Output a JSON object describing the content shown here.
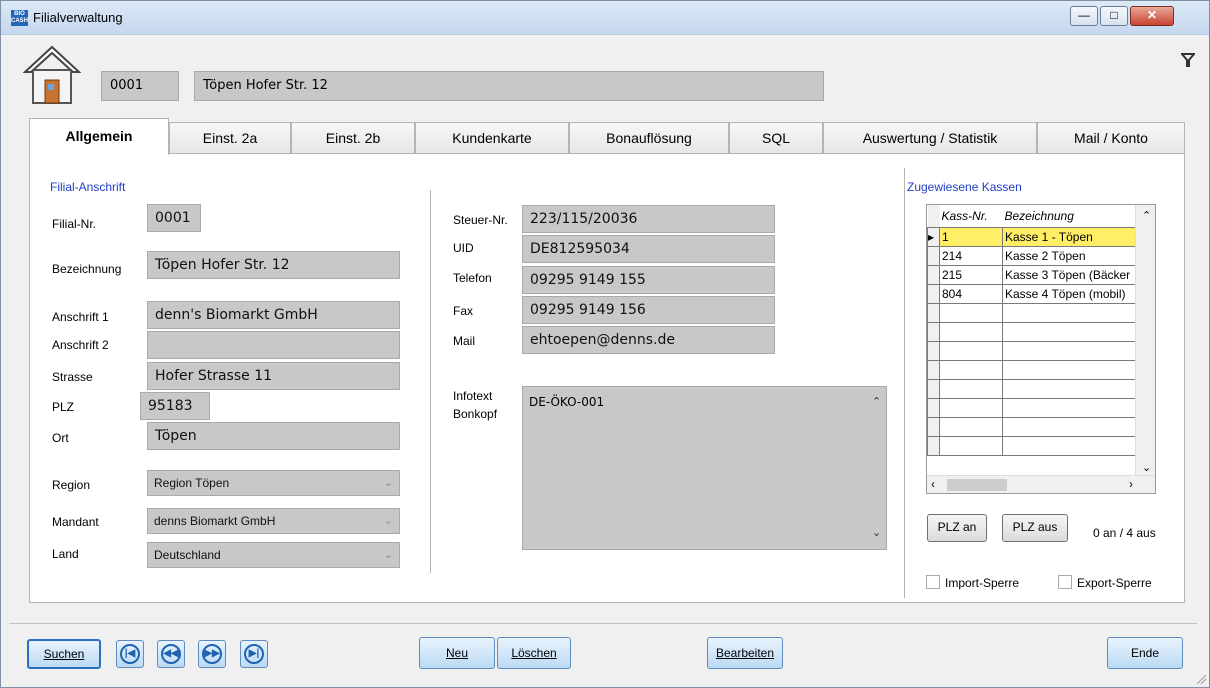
{
  "window": {
    "title": "Filialverwaltung",
    "icon_text": "BIO CASH"
  },
  "header": {
    "branch_no": "0001",
    "branch_name": "Töpen Hofer Str. 12"
  },
  "tabs": [
    "Allgemein",
    "Einst. 2a",
    "Einst. 2b",
    "Kundenkarte",
    "Bonauflösung",
    "SQL",
    "Auswertung / Statistik",
    "Mail / Konto"
  ],
  "address": {
    "section_title": "Filial-Anschrift",
    "labels": {
      "nr": "Filial-Nr.",
      "bez": "Bezeichnung",
      "a1": "Anschrift 1",
      "a2": "Anschrift 2",
      "str": "Strasse",
      "plz": "PLZ",
      "ort": "Ort",
      "region": "Region",
      "mandant": "Mandant",
      "land": "Land"
    },
    "values": {
      "nr": "0001",
      "bez": "Töpen Hofer Str. 12",
      "a1": "denn's Biomarkt GmbH",
      "a2": "",
      "str": "Hofer Strasse 11",
      "plz": "95183",
      "ort": "Töpen",
      "region": "Region Töpen",
      "mandant": "denns Biomarkt GmbH",
      "land": "Deutschland"
    }
  },
  "contact": {
    "labels": {
      "steuer": "Steuer-Nr.",
      "uid": "UID",
      "tel": "Telefon",
      "fax": "Fax",
      "mail": "Mail",
      "info1": "Infotext",
      "info2": "Bonkopf"
    },
    "values": {
      "steuer": "223/115/20036",
      "uid": "DE812595034",
      "tel": "09295 9149 155",
      "fax": "09295 9149 156",
      "mail": "ehtoepen@denns.de",
      "info": "DE-ÖKO-001"
    }
  },
  "kassen": {
    "title": "Zugewiesene Kassen",
    "columns": [
      "Kass-Nr.",
      "Bezeichnung"
    ],
    "rows": [
      [
        "1",
        "Kasse 1 - Töpen"
      ],
      [
        "214",
        "Kasse 2 Töpen"
      ],
      [
        "215",
        "Kasse 3 Töpen (Bäcker"
      ],
      [
        "804",
        "Kasse 4 Töpen (mobil)"
      ]
    ],
    "plz_an": "PLZ an",
    "plz_aus": "PLZ aus",
    "status": "0 an / 4 aus",
    "import_lock": "Import-Sperre",
    "export_lock": "Export-Sperre"
  },
  "footer": {
    "suchen": "Suchen",
    "neu": "Neu",
    "loeschen": "Löschen",
    "bearbeiten": "Bearbeiten",
    "ende": "Ende"
  }
}
